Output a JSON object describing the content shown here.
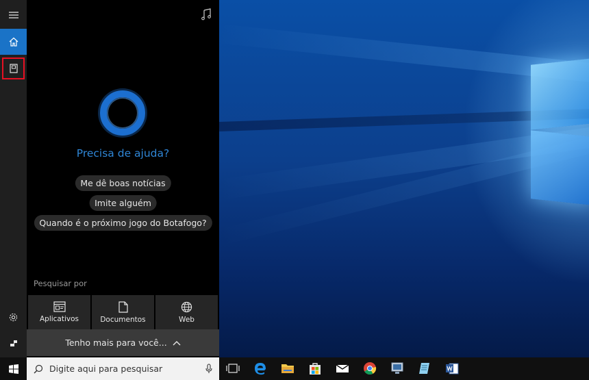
{
  "cortana": {
    "heading": "Precisa de ajuda?",
    "suggestions": [
      "Me dê boas notícias",
      "Imite alguém",
      "Quando é o próximo jogo do Botafogo?"
    ],
    "search_by_label": "Pesquisar por",
    "categories": [
      {
        "label": "Aplicativos",
        "icon": "apps-icon"
      },
      {
        "label": "Documentos",
        "icon": "document-icon"
      },
      {
        "label": "Web",
        "icon": "globe-icon"
      }
    ],
    "more_label": "Tenho mais para você..."
  },
  "taskbar": {
    "search_placeholder": "Digite aqui para pesquisar"
  },
  "colors": {
    "accent": "#1a73c7",
    "highlight_border": "#e81123",
    "heading_blue": "#2f86d6"
  }
}
